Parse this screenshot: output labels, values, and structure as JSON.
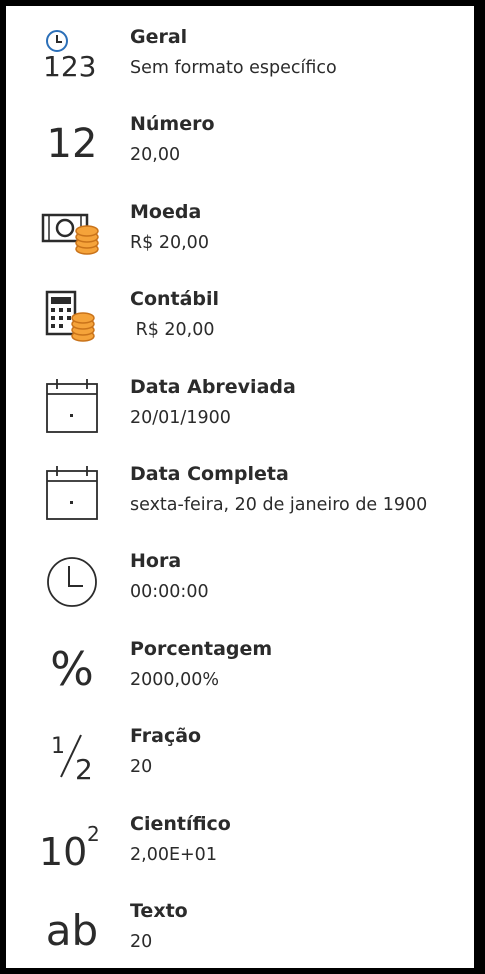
{
  "formats": [
    {
      "icon": "clock-123-icon",
      "label": "Geral",
      "example": "Sem formato específico"
    },
    {
      "icon": "number-12-icon",
      "glyph": "12",
      "label": "Número",
      "example": "20,00"
    },
    {
      "icon": "banknote-coins-icon",
      "label": "Moeda",
      "example": "R$ 20,00"
    },
    {
      "icon": "calculator-coins-icon",
      "label": "Contábil",
      "example": " R$ 20,00"
    },
    {
      "icon": "calendar-icon",
      "label": "Data Abreviada",
      "example": "20/01/1900"
    },
    {
      "icon": "calendar-icon",
      "label": "Data Completa",
      "example": "sexta-feira, 20 de janeiro de 1900"
    },
    {
      "icon": "clock-icon",
      "label": "Hora",
      "example": "00:00:00"
    },
    {
      "icon": "percent-icon",
      "glyph": "%",
      "label": "Porcentagem",
      "example": "2000,00%"
    },
    {
      "icon": "fraction-icon",
      "label": "Fração",
      "example": "20"
    },
    {
      "icon": "scientific-icon",
      "label": "Científico",
      "example": "2,00E+01"
    },
    {
      "icon": "text-ab-icon",
      "glyph": "ab",
      "label": "Texto",
      "example": "20"
    }
  ],
  "icon_glyphs": {
    "clock_digits": "123",
    "fraction_num": "1",
    "fraction_den": "2",
    "sci_base": "10",
    "sci_exp": "2"
  },
  "colors": {
    "text": "#2b2b2b",
    "coin": "#f5a33a",
    "coin_stroke": "#c9731a",
    "frame": "#000000"
  }
}
